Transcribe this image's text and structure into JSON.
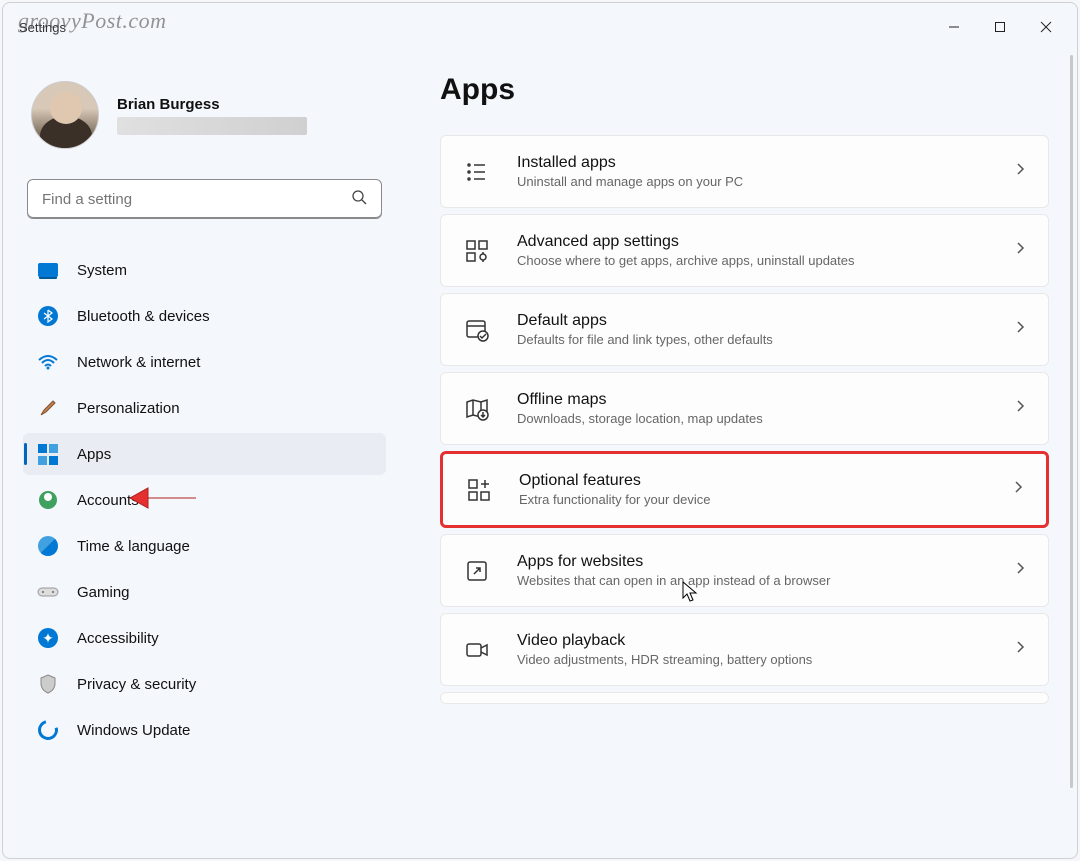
{
  "watermark": "groovyPost.com",
  "window": {
    "title": "Settings"
  },
  "user": {
    "name": "Brian Burgess"
  },
  "search": {
    "placeholder": "Find a setting"
  },
  "sidebar": {
    "items": [
      {
        "id": "system",
        "label": "System"
      },
      {
        "id": "bluetooth",
        "label": "Bluetooth & devices"
      },
      {
        "id": "network",
        "label": "Network & internet"
      },
      {
        "id": "personalization",
        "label": "Personalization"
      },
      {
        "id": "apps",
        "label": "Apps",
        "selected": true
      },
      {
        "id": "accounts",
        "label": "Accounts"
      },
      {
        "id": "time",
        "label": "Time & language"
      },
      {
        "id": "gaming",
        "label": "Gaming"
      },
      {
        "id": "accessibility",
        "label": "Accessibility"
      },
      {
        "id": "privacy",
        "label": "Privacy & security"
      },
      {
        "id": "update",
        "label": "Windows Update"
      }
    ]
  },
  "page": {
    "title": "Apps"
  },
  "cards": [
    {
      "id": "installed",
      "title": "Installed apps",
      "desc": "Uninstall and manage apps on your PC"
    },
    {
      "id": "advanced",
      "title": "Advanced app settings",
      "desc": "Choose where to get apps, archive apps, uninstall updates"
    },
    {
      "id": "default",
      "title": "Default apps",
      "desc": "Defaults for file and link types, other defaults"
    },
    {
      "id": "offline",
      "title": "Offline maps",
      "desc": "Downloads, storage location, map updates"
    },
    {
      "id": "optional",
      "title": "Optional features",
      "desc": "Extra functionality for your device",
      "highlighted": true
    },
    {
      "id": "websites",
      "title": "Apps for websites",
      "desc": "Websites that can open in an app instead of a browser"
    },
    {
      "id": "video",
      "title": "Video playback",
      "desc": "Video adjustments, HDR streaming, battery options"
    }
  ]
}
